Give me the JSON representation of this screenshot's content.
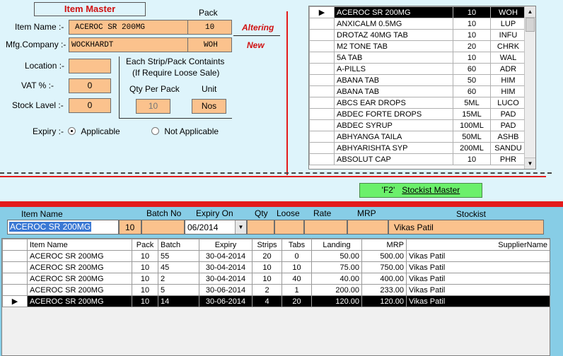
{
  "form": {
    "title": "Item Master",
    "pack_header": "Pack",
    "item_name_label": "Item Name :-",
    "item_name_value": "ACEROC SR 200MG",
    "item_pack_value": "10",
    "mfg_label": "Mfg.Company :-",
    "mfg_value": "WOCKHARDT",
    "mfg_code": "WOH",
    "altering_label": "Altering",
    "new_label": "New",
    "location_label": "Location :-",
    "location_value": "",
    "vat_label": "VAT % :-",
    "vat_value": "0",
    "stock_label": "Stock Lavel :-",
    "stock_value": "0",
    "strip_caption_1": "Each Strip/Pack Containts",
    "strip_caption_2": "(If Require Loose Sale)",
    "qty_per_pack_label": "Qty Per Pack",
    "unit_label": "Unit",
    "qty_per_pack_value": "10",
    "unit_value": "Nos",
    "expiry_label": "Expiry :-",
    "expiry_opt1": "Applicable",
    "expiry_opt2": "Not Applicable"
  },
  "item_list": [
    {
      "name": "ACEROC SR 200MG",
      "pack": "10",
      "code": "WOH",
      "selected": true
    },
    {
      "name": "ANXICALM 0.5MG",
      "pack": "10",
      "code": "LUP"
    },
    {
      "name": "DROTAZ  40MG TAB",
      "pack": "10",
      "code": "INFU"
    },
    {
      "name": "M2 TONE TAB",
      "pack": "20",
      "code": "CHRK"
    },
    {
      "name": "5A TAB",
      "pack": "10",
      "code": "WAL"
    },
    {
      "name": "A-PILLS",
      "pack": "60",
      "code": "ADR"
    },
    {
      "name": "ABANA TAB",
      "pack": "50",
      "code": "HIM"
    },
    {
      "name": "ABANA TAB",
      "pack": "60",
      "code": "HIM"
    },
    {
      "name": "ABCS EAR DROPS",
      "pack": "5ML",
      "code": "LUCO"
    },
    {
      "name": "ABDEC FORTE DROPS",
      "pack": "15ML",
      "code": "PAD"
    },
    {
      "name": "ABDEC SYRUP",
      "pack": "100ML",
      "code": "PAD"
    },
    {
      "name": "ABHYANGA TAILA",
      "pack": "50ML",
      "code": "ASHB"
    },
    {
      "name": "ABHYARISHTA   SYP",
      "pack": "200ML",
      "code": "SANDU"
    },
    {
      "name": "ABSOLUT CAP",
      "pack": "10",
      "code": "PHR"
    }
  ],
  "stockist_button": {
    "key": "'F2'",
    "label": "Stockist Master"
  },
  "entry": {
    "headers": {
      "item_name": "Item Name",
      "batch_no": "Batch No",
      "expiry": "Expiry On",
      "qty": "Qty",
      "loose": "Loose",
      "rate": "Rate",
      "mrp": "MRP",
      "stockist": "Stockist"
    },
    "item_name": "ACEROC SR 200MG",
    "pack": "10",
    "batch_no": "",
    "expiry": "06/2014",
    "qty": "",
    "loose": "",
    "rate": "",
    "mrp": "",
    "stockist": "Vikas Patil"
  },
  "grid": {
    "columns": [
      "Item Name",
      "Pack",
      "Batch",
      "Expiry",
      "Strips",
      "Tabs",
      "Landing",
      "MRP",
      "SupplierName"
    ],
    "rows": [
      {
        "item": "ACEROC SR 200MG",
        "pack": "10",
        "batch": "55",
        "expiry": "30-04-2014",
        "strips": "20",
        "tabs": "0",
        "landing": "50.00",
        "mrp": "500.00",
        "supplier": "Vikas Patil"
      },
      {
        "item": "ACEROC SR 200MG",
        "pack": "10",
        "batch": "45",
        "expiry": "30-04-2014",
        "strips": "10",
        "tabs": "10",
        "landing": "75.00",
        "mrp": "750.00",
        "supplier": "Vikas Patil"
      },
      {
        "item": "ACEROC SR 200MG",
        "pack": "10",
        "batch": "2",
        "expiry": "30-04-2014",
        "strips": "10",
        "tabs": "40",
        "landing": "40.00",
        "mrp": "400.00",
        "supplier": "Vikas Patil"
      },
      {
        "item": "ACEROC SR 200MG",
        "pack": "10",
        "batch": "5",
        "expiry": "30-06-2014",
        "strips": "2",
        "tabs": "1",
        "landing": "200.00",
        "mrp": "233.00",
        "supplier": "Vikas Patil"
      },
      {
        "item": "ACEROC SR 200MG",
        "pack": "10",
        "batch": "14",
        "expiry": "30-06-2014",
        "strips": "4",
        "tabs": "20",
        "landing": "120.00",
        "mrp": "120.00",
        "supplier": "Vikas Patil",
        "selected": true
      }
    ]
  }
}
